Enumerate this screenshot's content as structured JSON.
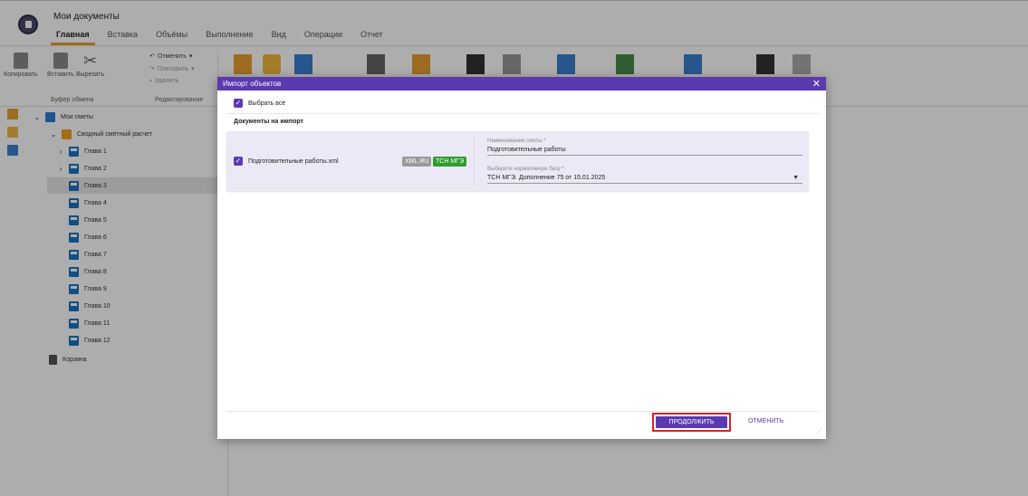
{
  "app": {
    "title": "Мои документы",
    "menu": [
      "Главная",
      "Вставка",
      "Объёмы",
      "Выполнение",
      "Вид",
      "Операции",
      "Отчет"
    ]
  },
  "ribbon": {
    "copy": "Копировать",
    "paste": "Вставить",
    "cut": "Вырезать",
    "clipboard_group": "Буфер обмена",
    "undo": "Отменить",
    "redo": "Повторить",
    "delete": "Удалить",
    "edit_group": "Редактирование"
  },
  "tree": {
    "root": "Мои сметы",
    "summary": "Сводный сметный расчет",
    "chapters": [
      "Глава 1",
      "Глава 2",
      "Глава 3",
      "Глава 4",
      "Глава 5",
      "Глава 6",
      "Глава 7",
      "Глава 8",
      "Глава 9",
      "Глава 10",
      "Глава 11",
      "Глава 12"
    ],
    "selected_chapter": "Глава 3",
    "trash": "Корзина"
  },
  "modal": {
    "title": "Импорт объектов",
    "select_all": "Выбрать всё",
    "section_title": "Документы на импорт",
    "document": {
      "filename": "Подготовительные работы.xml",
      "tags": [
        "XML.RU",
        "ТСН МГЭ"
      ],
      "name_label": "Наименование сметы *",
      "name_value": "Подготовительные работы",
      "base_label": "Выберите нормативную базу *",
      "base_value": "ТСН МГЭ. Дополнение 75 от 15.01.2025"
    },
    "continue_button": "ПРОДОЛЖИТЬ",
    "cancel_button": "ОТМЕНИТЬ"
  },
  "colors": {
    "accent": "#5b3ab0",
    "tab_underline": "#e8a030",
    "tag_green": "#2e9e2e",
    "highlight_border": "#e02020"
  }
}
